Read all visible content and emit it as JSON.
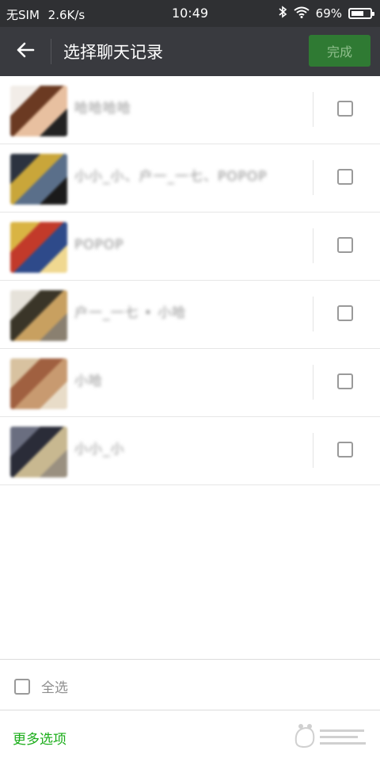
{
  "status_bar": {
    "carrier": "无SIM",
    "speed": "2.6K/s",
    "time": "10:49",
    "battery": "69%",
    "battery_level": 0.69
  },
  "header": {
    "back_icon": "arrow-left-icon",
    "title": "选择聊天记录",
    "done_label": "完成",
    "done_color": "#2f7a33"
  },
  "chats": [
    {
      "name": "哈哈哈哈",
      "avatar_colors": [
        "#f2ede8",
        "#6b3a22",
        "#e8c0a0",
        "#222222"
      ],
      "checked": false
    },
    {
      "name": "小小_小、户一_一七、POPOP",
      "avatar_colors": [
        "#2c3340",
        "#c9a63a",
        "#5a6f8a",
        "#1a1a1a"
      ],
      "checked": false
    },
    {
      "name": "POPOP",
      "avatar_colors": [
        "#d9b443",
        "#c23a2a",
        "#2e4a8a",
        "#f0d890"
      ],
      "checked": false
    },
    {
      "name": "户一_一七 • 小哈",
      "avatar_colors": [
        "#e6e2da",
        "#3a3528",
        "#c8a060",
        "#8a8070"
      ],
      "checked": false
    },
    {
      "name": "小哈",
      "avatar_colors": [
        "#d8c2a0",
        "#a06040",
        "#c89a70",
        "#e8dcc8"
      ],
      "checked": false
    },
    {
      "name": "小小_小",
      "avatar_colors": [
        "#6a6e80",
        "#2a2c38",
        "#c8b890",
        "#9a9080"
      ],
      "checked": false
    }
  ],
  "footer": {
    "select_all_label": "全选",
    "more_options_label": "更多选项",
    "accent": "#1aad19"
  }
}
